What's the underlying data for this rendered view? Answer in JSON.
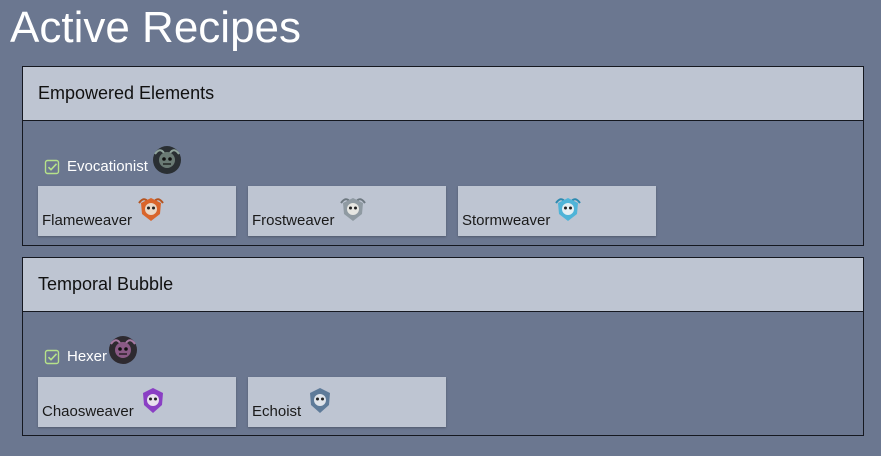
{
  "page": {
    "title": "Active Recipes"
  },
  "recipes": [
    {
      "name": "Empowered Elements",
      "result": {
        "label": "Evocationist",
        "checked": true,
        "icon": "evocationist-emblem-icon",
        "color": "#6a7a74"
      },
      "ingredients": [
        {
          "label": "Flameweaver",
          "icon": "flameweaver-emblem-icon",
          "color": "#d9652b"
        },
        {
          "label": "Frostweaver",
          "icon": "frostweaver-emblem-icon",
          "color": "#8f9aa2"
        },
        {
          "label": "Stormweaver",
          "icon": "stormweaver-emblem-icon",
          "color": "#4fb4d8"
        }
      ]
    },
    {
      "name": "Temporal Bubble",
      "result": {
        "label": "Hexer",
        "checked": true,
        "icon": "hexer-emblem-icon",
        "color": "#8a5a86"
      },
      "ingredients": [
        {
          "label": "Chaosweaver",
          "icon": "chaosweaver-emblem-icon",
          "color": "#8a3fc4"
        },
        {
          "label": "Echoist",
          "icon": "echoist-emblem-icon",
          "color": "#5e7b99"
        }
      ]
    }
  ],
  "colors": {
    "background": "#6b7790",
    "panel": "#bec5d2",
    "check": "#b6e28a"
  }
}
